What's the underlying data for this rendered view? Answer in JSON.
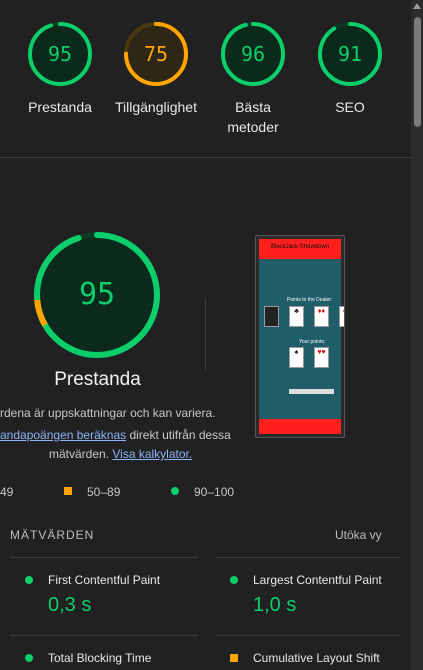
{
  "categories": [
    {
      "label": "Prestanda",
      "score": "95",
      "value": 95,
      "color": "#0cce6b",
      "track": "#0b3b22",
      "fill": "#0c2a1b"
    },
    {
      "label": "Tillgänglighet",
      "score": "75",
      "value": 75,
      "color": "#ffa400",
      "track": "#4a3a12",
      "fill": "#2e2616"
    },
    {
      "label": "Bästa",
      "label2": "metoder",
      "score": "96",
      "value": 96,
      "color": "#0cce6b",
      "track": "#0b3b22",
      "fill": "#0c2a1b"
    },
    {
      "label": "SEO",
      "score": "91",
      "value": 91,
      "color": "#0cce6b",
      "track": "#0b3b22",
      "fill": "#0c2a1b"
    }
  ],
  "performance": {
    "score": "95",
    "value": 95,
    "title": "Prestanda",
    "note_line1": "rdena är uppskattningar och kan variera.",
    "note_link1": "andapoängen beräknas",
    "note_line2_rest": " direkt utifrån dessa",
    "note_line3_a": "mätvärden.",
    "note_link2": "Visa kalkylator."
  },
  "legend": {
    "fail": "49",
    "average": "50–89",
    "pass": "90–100"
  },
  "metrics": {
    "header": "MÄTVÄRDEN",
    "expand": "Utöka vy",
    "items": [
      {
        "label": "First Contentful Paint",
        "value": "0,3 s",
        "status": "pass"
      },
      {
        "label": "Largest Contentful Paint",
        "value": "1,0 s",
        "status": "pass"
      },
      {
        "label": "Total Blocking Time",
        "value": "",
        "status": "pass"
      },
      {
        "label": "Cumulative Layout Shift",
        "value": "",
        "status": "average"
      }
    ]
  },
  "thumbnail": {
    "title": "BlackJack Showdown",
    "dealer_label": "Points to the Dealer:",
    "your_label": "Your points:"
  },
  "colors": {
    "pass": "#0cce6b",
    "average": "#ffa400",
    "fail": "#ff4e42",
    "link": "#8ab4f8"
  }
}
